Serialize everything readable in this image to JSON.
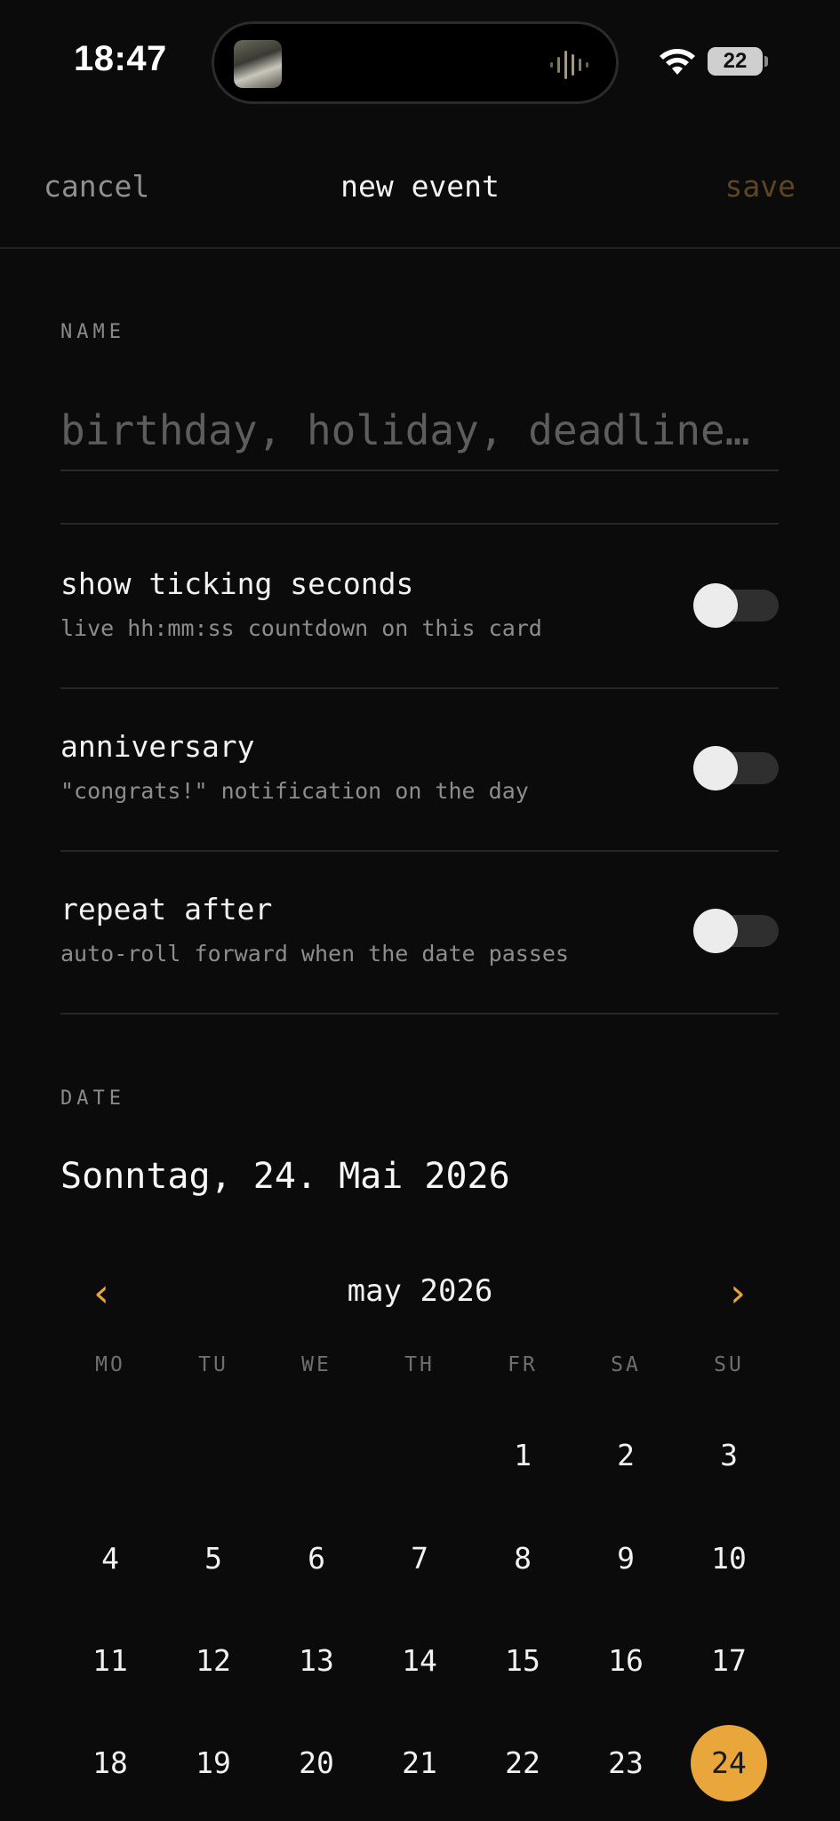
{
  "status_bar": {
    "time": "18:47",
    "battery": "22",
    "wifi_icon": "wifi-icon"
  },
  "header": {
    "cancel": "cancel",
    "title": "new event",
    "save": "save"
  },
  "name_section": {
    "label": "NAME",
    "placeholder": "birthday, holiday, deadline…",
    "value": ""
  },
  "toggles": [
    {
      "title": "show ticking seconds",
      "subtitle": "live hh:mm:ss countdown on this card",
      "on": false
    },
    {
      "title": "anniversary",
      "subtitle": "\"congrats!\" notification on the day",
      "on": false
    },
    {
      "title": "repeat after",
      "subtitle": "auto-roll forward when the date passes",
      "on": false
    }
  ],
  "date_section": {
    "label": "DATE",
    "selected_text": "Sonntag, 24. Mai 2026"
  },
  "calendar": {
    "month_label": "may 2026",
    "prev_icon": "‹",
    "next_icon": "›",
    "weekdays": [
      "MO",
      "TU",
      "WE",
      "TH",
      "FR",
      "SA",
      "SU"
    ],
    "weeks": [
      [
        "",
        "",
        "",
        "",
        "1",
        "2",
        "3"
      ],
      [
        "4",
        "5",
        "6",
        "7",
        "8",
        "9",
        "10"
      ],
      [
        "11",
        "12",
        "13",
        "14",
        "15",
        "16",
        "17"
      ],
      [
        "18",
        "19",
        "20",
        "21",
        "22",
        "23",
        "24"
      ]
    ],
    "selected_day": "24"
  },
  "colors": {
    "accent": "#e9a63a",
    "background": "#0b0b0b",
    "save_disabled": "#5e4624"
  }
}
